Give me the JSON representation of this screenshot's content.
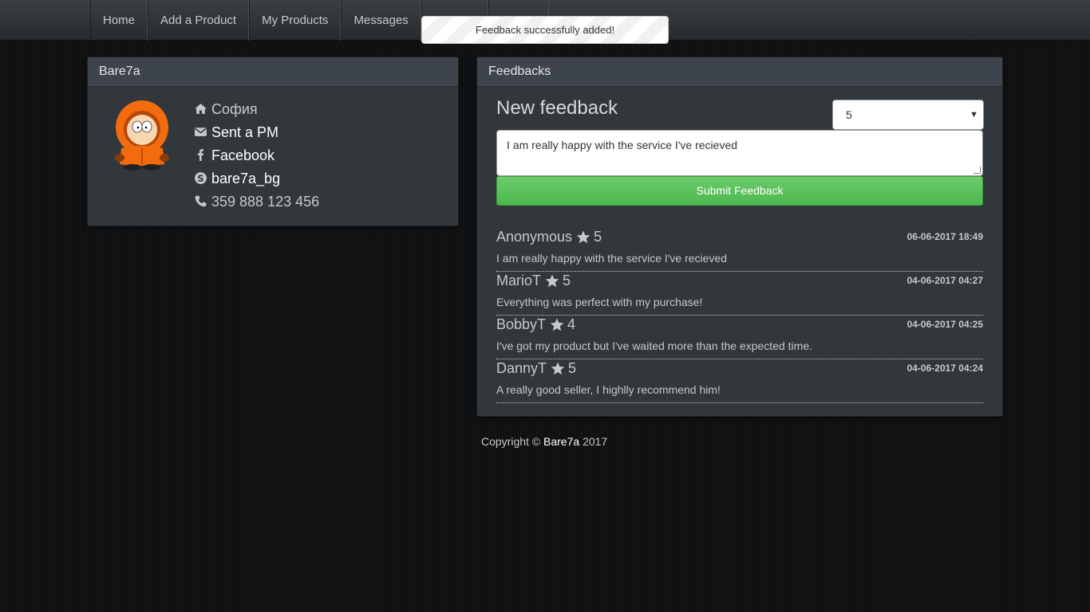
{
  "nav": {
    "items": [
      {
        "label": "Home"
      },
      {
        "label": "Add a Product"
      },
      {
        "label": "My Products"
      },
      {
        "label": "Messages"
      }
    ]
  },
  "toast": {
    "message": "Feedback successfully added!"
  },
  "profile": {
    "username": "Bare7a",
    "city": "София",
    "pm_label": "Sent a PM",
    "facebook": "Facebook",
    "skype": "bare7a_bg",
    "phone": "359 888 123 456"
  },
  "feedbacks": {
    "heading": "Feedbacks",
    "form": {
      "title": "New feedback",
      "rating_value": "5",
      "text_value": "I am really happy with the service I've recieved",
      "submit_label": "Submit Feedback"
    },
    "items": [
      {
        "author": "Anonymous",
        "rating": "5",
        "date": "06-06-2017 18:49",
        "text": "I am really happy with the service I've recieved"
      },
      {
        "author": "MarioT",
        "rating": "5",
        "date": "04-06-2017 04:27",
        "text": "Everything was perfect with my purchase!"
      },
      {
        "author": "BobbyT",
        "rating": "4",
        "date": "04-06-2017 04:25",
        "text": "I've got my product but I've waited more than the expected time."
      },
      {
        "author": "DannyT",
        "rating": "5",
        "date": "04-06-2017 04:24",
        "text": "A really good seller, I highlly recommend him!"
      }
    ]
  },
  "footer": {
    "prefix": "Copyright ©",
    "brand": "Bare7a",
    "year": "2017"
  },
  "colors": {
    "accent_green": "#5cb85c",
    "panel_bg": "#32373c",
    "background": "#111213"
  },
  "icons": [
    "home-icon",
    "envelope-icon",
    "facebook-icon",
    "skype-icon",
    "phone-icon",
    "star-icon",
    "avatar"
  ]
}
